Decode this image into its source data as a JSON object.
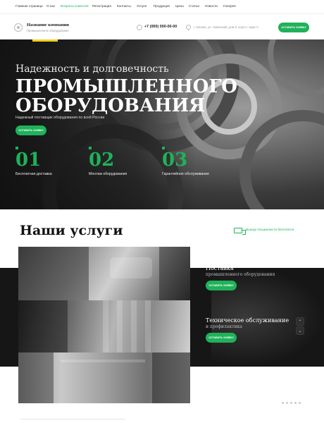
{
  "nav": {
    "items": [
      {
        "label": "Главная страница"
      },
      {
        "label": "О нас"
      },
      {
        "label": "Вопросы клиентов",
        "active": true
      },
      {
        "label": "Регистрация"
      },
      {
        "label": "Контакты"
      },
      {
        "label": "Услуги"
      },
      {
        "label": "Продукция"
      },
      {
        "label": "Цены"
      },
      {
        "label": "Статьи"
      },
      {
        "label": "Новости"
      },
      {
        "label": "Галерея"
      }
    ]
  },
  "header": {
    "company_name": "Название компании",
    "company_sub": "Промышленное оборудование",
    "phone": "+7 (000) 000-00-00",
    "address": "г. Москва, ул. Новинский, дом 0, корп.0, офис 0",
    "cta_label": "Оставить заявку"
  },
  "hero": {
    "subtitle": "Надежность и долговечность",
    "title_line1": "ПРОМЫШЛЕННОГО",
    "title_line2": "ОБОРУДОВАНИЯ",
    "tagline": "Надежный поставщик оборудования по всей России",
    "cta_label": "Оставить заявку",
    "features": [
      {
        "num": "01",
        "label": "Бесплатная доставка"
      },
      {
        "num": "02",
        "label": "Монтаж оборудования"
      },
      {
        "num": "03",
        "label": "Гарантийное обслуживание"
      }
    ]
  },
  "services": {
    "title": "Наши услуги",
    "specialist_link": "Выезд специалиста бесплатно",
    "items": [
      {
        "title": "Поставка",
        "subtitle": "промышленного оборудования",
        "cta_label": "Оставить заявку"
      },
      {
        "title": "Техническое обслуживание",
        "subtitle": "и профилактика",
        "cta_label": "Оставить заявку"
      }
    ],
    "arrow_up": "⌃",
    "arrow_down": "⌄"
  },
  "colors": {
    "accent": "#1fb25a",
    "dark": "#161616"
  },
  "icons": [
    "logo-mark-icon",
    "phone-icon",
    "map-pin-icon",
    "truck-icon",
    "chevron-up-icon",
    "chevron-down-icon"
  ]
}
